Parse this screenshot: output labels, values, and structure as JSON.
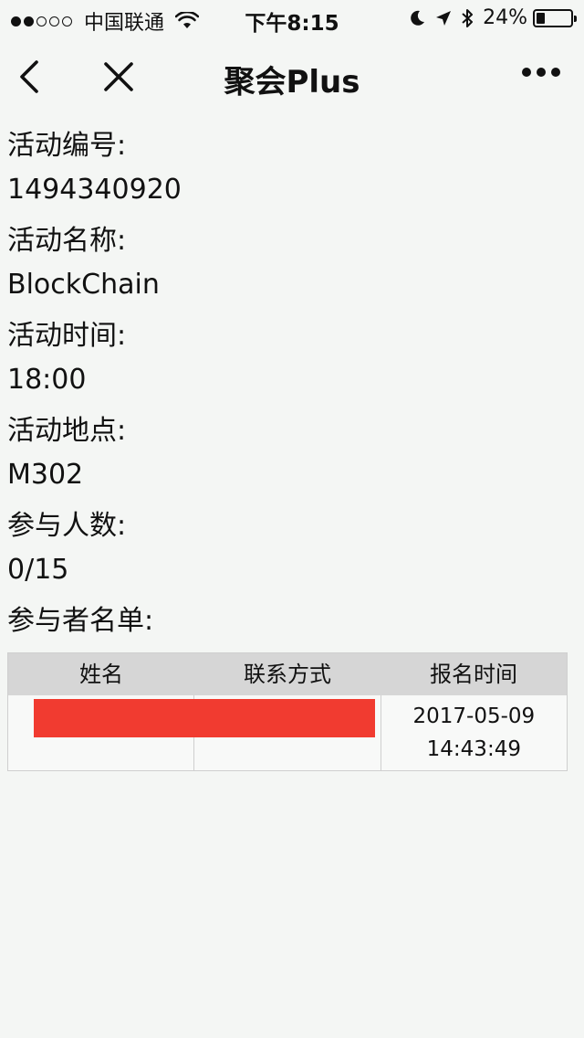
{
  "status_bar": {
    "carrier": "中国联通",
    "time": "下午8:15",
    "battery": "24%",
    "battery_level": 0.24,
    "signal_strength": 2
  },
  "nav": {
    "title": "聚会Plus",
    "back_icon": "chevron-left-icon",
    "close_icon": "close-icon",
    "more_icon": "more-icon"
  },
  "fields": [
    {
      "label": "活动编号:",
      "value": "1494340920"
    },
    {
      "label": "活动名称:",
      "value": "BlockChain"
    },
    {
      "label": "活动时间:",
      "value": "18:00"
    },
    {
      "label": "活动地点:",
      "value": "M302"
    },
    {
      "label": "参与人数:",
      "value": "0/15"
    }
  ],
  "participants": {
    "label": "参与者名单:",
    "columns": [
      "姓名",
      "联系方式",
      "报名时间"
    ],
    "rows": [
      {
        "name": "",
        "contact": "",
        "date": "2017-05-09",
        "time": "14:43:49"
      }
    ],
    "redaction_color": "#f13b30"
  }
}
